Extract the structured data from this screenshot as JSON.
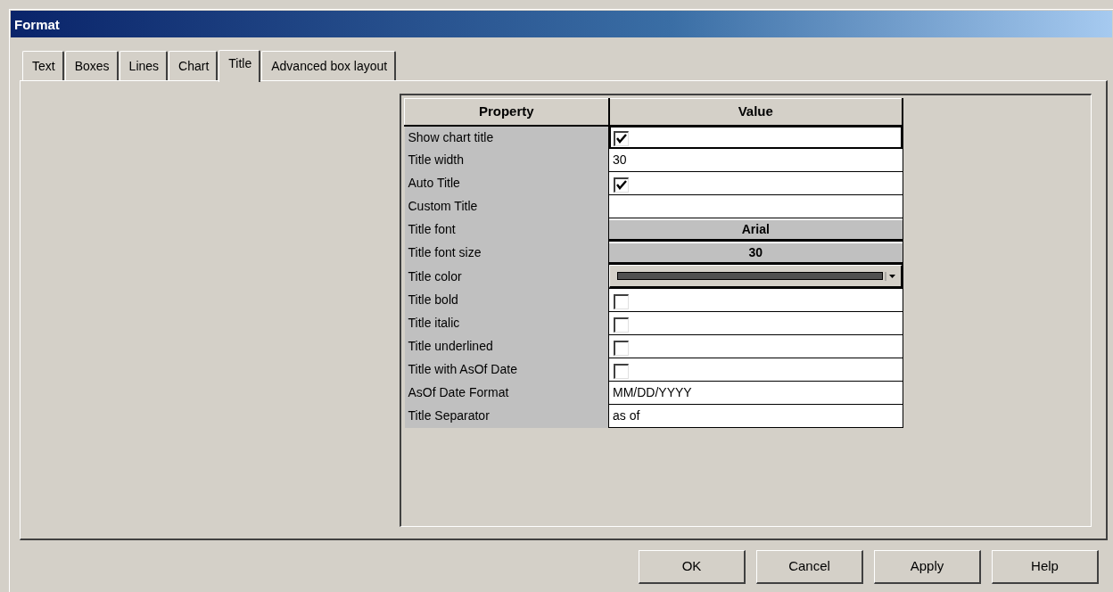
{
  "window": {
    "title": "Format"
  },
  "tabs": [
    {
      "label": "Text",
      "selected": false
    },
    {
      "label": "Boxes",
      "selected": false
    },
    {
      "label": "Lines",
      "selected": false
    },
    {
      "label": "Chart",
      "selected": false
    },
    {
      "label": "Title",
      "selected": true
    },
    {
      "label": "Advanced box layout",
      "selected": false
    }
  ],
  "grid": {
    "columns": [
      "Property",
      "Value"
    ],
    "rows": [
      {
        "property": "Show chart title",
        "kind": "checkbox",
        "checked": true,
        "focused": true
      },
      {
        "property": "Title width",
        "kind": "text",
        "value": "30"
      },
      {
        "property": "Auto Title",
        "kind": "checkbox",
        "checked": true
      },
      {
        "property": "Custom Title",
        "kind": "text"
      },
      {
        "property": "Title font",
        "kind": "button",
        "value": "Arial"
      },
      {
        "property": "Title font size",
        "kind": "button",
        "value": "30"
      },
      {
        "property": "Title color",
        "kind": "color",
        "color": "#505050"
      },
      {
        "property": "Title bold",
        "kind": "checkbox",
        "checked": false
      },
      {
        "property": "Title italic",
        "kind": "checkbox",
        "checked": false
      },
      {
        "property": "Title underlined",
        "kind": "checkbox",
        "checked": false
      },
      {
        "property": "Title with AsOf Date",
        "kind": "checkbox",
        "checked": false
      },
      {
        "property": "AsOf Date Format",
        "kind": "text",
        "value": "MM/DD/YYYY"
      },
      {
        "property": "Title Separator",
        "kind": "text",
        "value": "as of"
      }
    ]
  },
  "buttons": [
    "OK",
    "Cancel",
    "Apply",
    "Help"
  ]
}
